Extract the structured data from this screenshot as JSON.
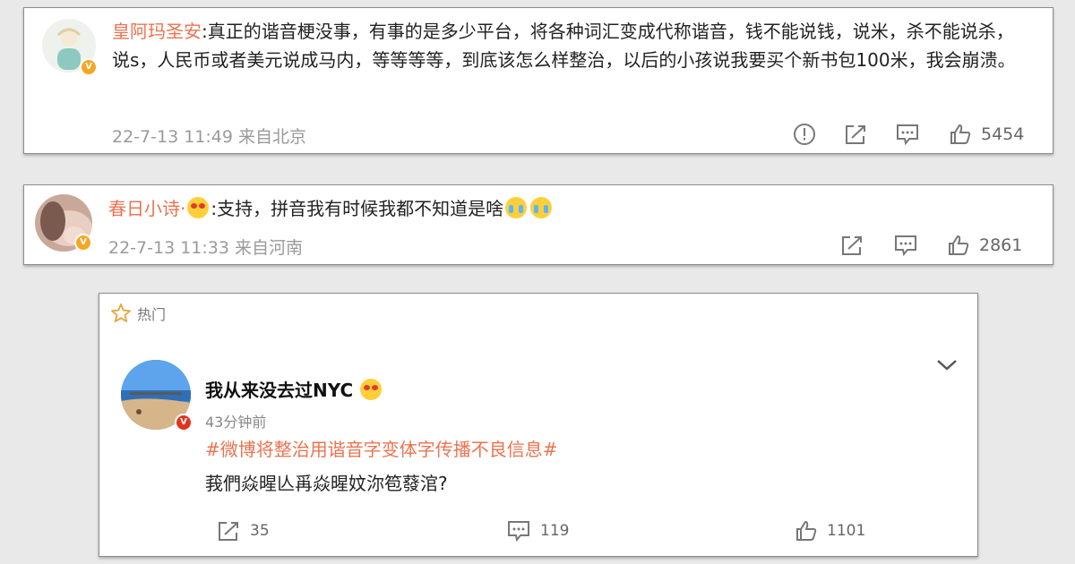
{
  "comments": [
    {
      "username": "皇阿玛圣安",
      "text": ":真正的谐音梗没事，有事的是多少平台，将各种词汇变成代称谐音，钱不能说钱，说米，杀不能说杀，说s，人民币或者美元说成马内，等等等等，到底该怎么样整治，以后的小孩说我要买个新书包100米，我会崩溃。",
      "meta": "22-7-13 11:49 来自北京",
      "likes": "5454"
    },
    {
      "username": "春日小诗·",
      "text": ":支持，拼音我有时候我都不知道是啥",
      "meta": "22-7-13 11:33 来自河南",
      "likes": "2861"
    }
  ],
  "hot_post": {
    "section_label": "热门",
    "username": "我从来没去过NYC",
    "time": "43分钟前",
    "hashtag": "#微博将整治用谐音字变体字传播不良信息#",
    "body": "莪們焱暒亾爯焱暒妏沵笣蕟涫?",
    "reposts": "35",
    "comments": "119",
    "likes": "1101"
  },
  "colors": {
    "username": "#eb7350",
    "meta": "#9a9a9a",
    "badge_gold": "#f5a623",
    "badge_red": "#e3331f"
  },
  "icons": [
    "report-icon",
    "share-icon",
    "comment-icon",
    "like-icon",
    "star-icon",
    "chevron-down-icon",
    "crying-emoji",
    "verified-badge"
  ]
}
